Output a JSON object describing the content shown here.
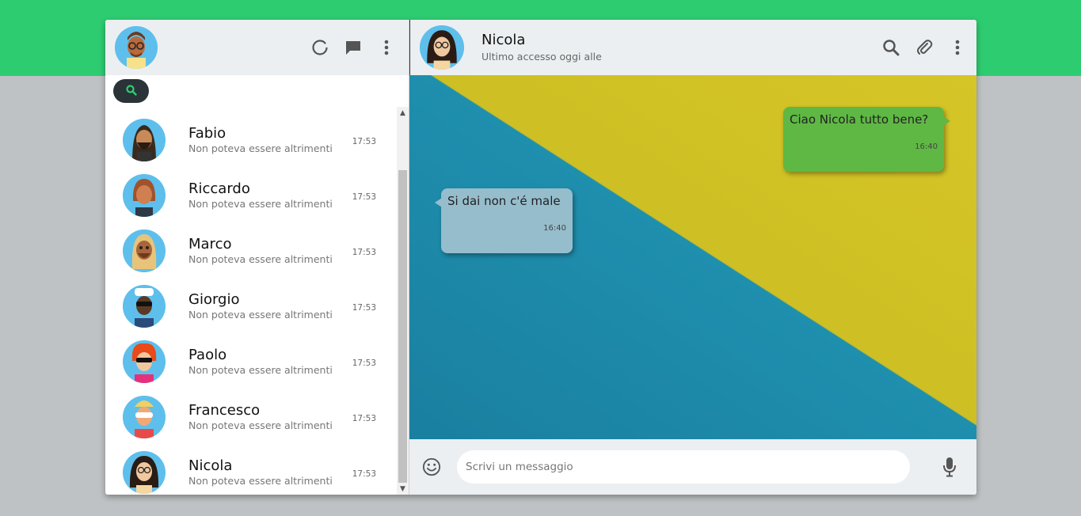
{
  "colors": {
    "brand": "#2ecc71",
    "page_bg": "#bfc2c4",
    "panel_header": "#eceff1",
    "sent_bubble": "#5fb844",
    "received_bubble": "#96bdcc"
  },
  "sidebar": {
    "icons": [
      "status-icon",
      "new-chat-icon",
      "menu-icon"
    ],
    "search_icon": "search-icon",
    "contacts": [
      {
        "name": "Fabio",
        "preview": "Non poteva essere altrimenti",
        "time": "17:53"
      },
      {
        "name": "Riccardo",
        "preview": "Non poteva essere altrimenti",
        "time": "17:53"
      },
      {
        "name": "Marco",
        "preview": "Non poteva essere altrimenti",
        "time": "17:53"
      },
      {
        "name": "Giorgio",
        "preview": "Non poteva essere altrimenti",
        "time": "17:53"
      },
      {
        "name": "Paolo",
        "preview": "Non poteva essere altrimenti",
        "time": "17:53"
      },
      {
        "name": "Francesco",
        "preview": "Non poteva essere altrimenti",
        "time": "17:53"
      },
      {
        "name": "Nicola",
        "preview": "Non poteva essere altrimenti",
        "time": "17:53"
      }
    ]
  },
  "chat": {
    "name": "Nicola",
    "status": "Ultimo accesso oggi alle",
    "icons": [
      "search-icon",
      "paperclip-icon",
      "menu-icon"
    ],
    "messages": [
      {
        "direction": "sent",
        "text": "Ciao Nicola tutto bene?",
        "time": "16:40"
      },
      {
        "direction": "received",
        "text": "Si dai non c'é male",
        "time": "16:40"
      }
    ],
    "input_placeholder": "Scrivi un messaggio",
    "emoji_icon": "smiley-icon",
    "mic_icon": "microphone-icon"
  }
}
